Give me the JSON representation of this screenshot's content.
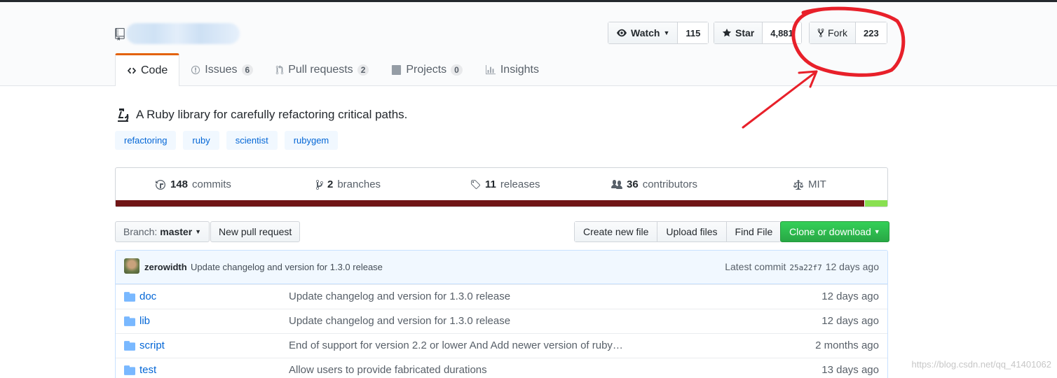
{
  "header": {
    "watch": {
      "label": "Watch",
      "count": "115"
    },
    "star": {
      "label": "Star",
      "count": "4,881"
    },
    "fork": {
      "label": "Fork",
      "count": "223"
    }
  },
  "tabs": [
    {
      "label": "Code",
      "icon": "code-icon",
      "counter": ""
    },
    {
      "label": "Issues",
      "icon": "issue-icon",
      "counter": "6"
    },
    {
      "label": "Pull requests",
      "icon": "pull-request-icon",
      "counter": "2"
    },
    {
      "label": "Projects",
      "icon": "project-icon",
      "counter": "0"
    },
    {
      "label": "Insights",
      "icon": "graph-icon",
      "counter": ""
    }
  ],
  "description": "A Ruby library for carefully refactoring critical paths.",
  "topics": [
    "refactoring",
    "ruby",
    "scientist",
    "rubygem"
  ],
  "summary": {
    "commits": {
      "count": "148",
      "label": "commits"
    },
    "branches": {
      "count": "2",
      "label": "branches"
    },
    "releases": {
      "count": "11",
      "label": "releases"
    },
    "contributors": {
      "count": "36",
      "label": "contributors"
    },
    "license": "MIT"
  },
  "language_bar": [
    {
      "share": 0.97,
      "color": "#701516"
    },
    {
      "share": 0.03,
      "color": "#89e051"
    }
  ],
  "actions": {
    "branch_prefix": "Branch:",
    "branch": "master",
    "new_pull_request": "New pull request",
    "create_new_file": "Create new file",
    "upload_files": "Upload files",
    "find_file": "Find File",
    "clone_or_download": "Clone or download"
  },
  "latest_commit": {
    "author": "zerowidth",
    "message": "Update changelog and version for 1.3.0 release",
    "label": "Latest commit",
    "sha": "25a22f7",
    "age": "12 days ago"
  },
  "files": [
    {
      "name": "doc",
      "message": "Update changelog and version for 1.3.0 release",
      "age": "12 days ago"
    },
    {
      "name": "lib",
      "message": "Update changelog and version for 1.3.0 release",
      "age": "12 days ago"
    },
    {
      "name": "script",
      "message": "End of support for version 2.2 or lower And Add newer version of ruby…",
      "age": "2 months ago"
    },
    {
      "name": "test",
      "message": "Allow users to provide fabricated durations",
      "age": "13 days ago"
    }
  ],
  "watermark": "https://blog.csdn.net/qq_41401062",
  "colors": {
    "annotation": "#e8202a",
    "accent": "#e36209",
    "link": "#0366d6",
    "green": "#28a745"
  }
}
